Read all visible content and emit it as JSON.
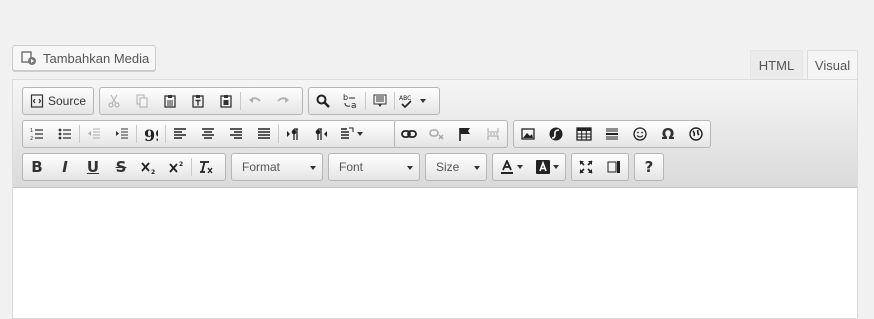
{
  "media_button": {
    "label": "Tambahkan Media",
    "icon": "media-icon"
  },
  "tabs": [
    {
      "label": "HTML"
    },
    {
      "label": "Visual",
      "active": true
    }
  ],
  "toolbar": {
    "source_label": "Source",
    "format_label": "Format",
    "font_label": "Font",
    "size_label": "Size"
  }
}
